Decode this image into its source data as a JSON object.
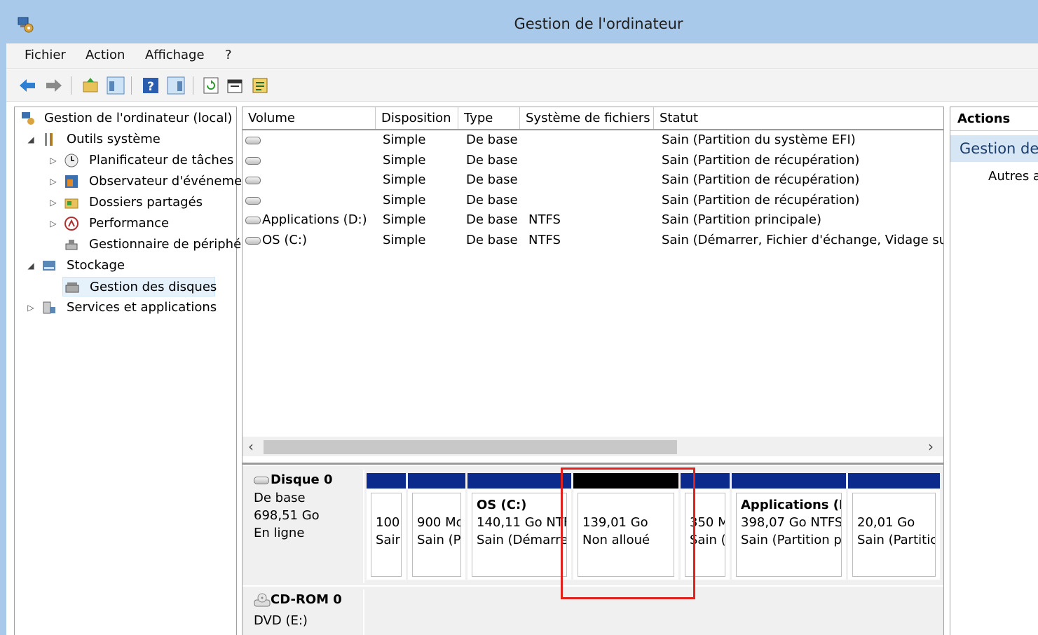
{
  "window": {
    "title": "Gestion de l'ordinateur"
  },
  "menu": [
    {
      "label": "Fichier"
    },
    {
      "label": "Action"
    },
    {
      "label": "Affichage"
    },
    {
      "label": "?"
    }
  ],
  "toolbar": {
    "buttons": [
      "back-icon",
      "forward-icon",
      "up-folder-icon",
      "show-hide-tree-icon",
      "help-icon",
      "show-hide-action-pane-icon",
      "refresh-icon",
      "properties-icon",
      "export-list-icon"
    ]
  },
  "tree": {
    "root": "Gestion de l'ordinateur (local)",
    "system_tools": "Outils système",
    "task_scheduler": "Planificateur de tâches",
    "event_viewer": "Observateur d'événeme",
    "shared_folders": "Dossiers partagés",
    "performance": "Performance",
    "device_manager": "Gestionnaire de périphé",
    "storage": "Stockage",
    "disk_management": "Gestion des disques",
    "services": "Services et applications"
  },
  "volumes": {
    "columns": [
      "Volume",
      "Disposition",
      "Type",
      "Système de fichiers",
      "Statut"
    ],
    "rows": [
      {
        "volume": "",
        "layout": "Simple",
        "type": "De base",
        "fs": "",
        "status": "Sain (Partition du système EFI)"
      },
      {
        "volume": "",
        "layout": "Simple",
        "type": "De base",
        "fs": "",
        "status": "Sain (Partition de récupération)"
      },
      {
        "volume": "",
        "layout": "Simple",
        "type": "De base",
        "fs": "",
        "status": "Sain (Partition de récupération)"
      },
      {
        "volume": "",
        "layout": "Simple",
        "type": "De base",
        "fs": "",
        "status": "Sain (Partition de récupération)"
      },
      {
        "volume": "Applications (D:)",
        "layout": "Simple",
        "type": "De base",
        "fs": "NTFS",
        "status": "Sain (Partition principale)"
      },
      {
        "volume": "OS (C:)",
        "layout": "Simple",
        "type": "De base",
        "fs": "NTFS",
        "status": "Sain (Démarrer, Fichier d'échange, Vidage sur"
      }
    ]
  },
  "disk0": {
    "name": "Disque 0",
    "type": "De base",
    "size": "698,51 Go",
    "state": "En ligne",
    "partitions": [
      {
        "title": "",
        "line1": "100",
        "line2": "Sair"
      },
      {
        "title": "",
        "line1": "900 Mo",
        "line2": "Sain (P"
      },
      {
        "title": "OS  (C:)",
        "line1": "140,11 Go NTF",
        "line2": "Sain (Démarre"
      },
      {
        "title": "",
        "line1": "139,01 Go",
        "line2": "Non alloué"
      },
      {
        "title": "",
        "line1": "350 M",
        "line2": "Sain ("
      },
      {
        "title": "Applications (D",
        "line1": "398,07 Go NTFS",
        "line2": "Sain (Partition p"
      },
      {
        "title": "",
        "line1": "20,01 Go",
        "line2": "Sain (Partitic"
      }
    ]
  },
  "cdrom0": {
    "name": "CD-ROM 0",
    "drive": "DVD (E:)"
  },
  "actions": {
    "header": "Actions",
    "group": "Gestion des disques",
    "other": "Autres actions"
  },
  "colors": {
    "partition_bar": "#0b2a8c",
    "unallocated_bar": "#000000",
    "highlight": "#e0211c",
    "titlebar": "#a9c9ea"
  }
}
